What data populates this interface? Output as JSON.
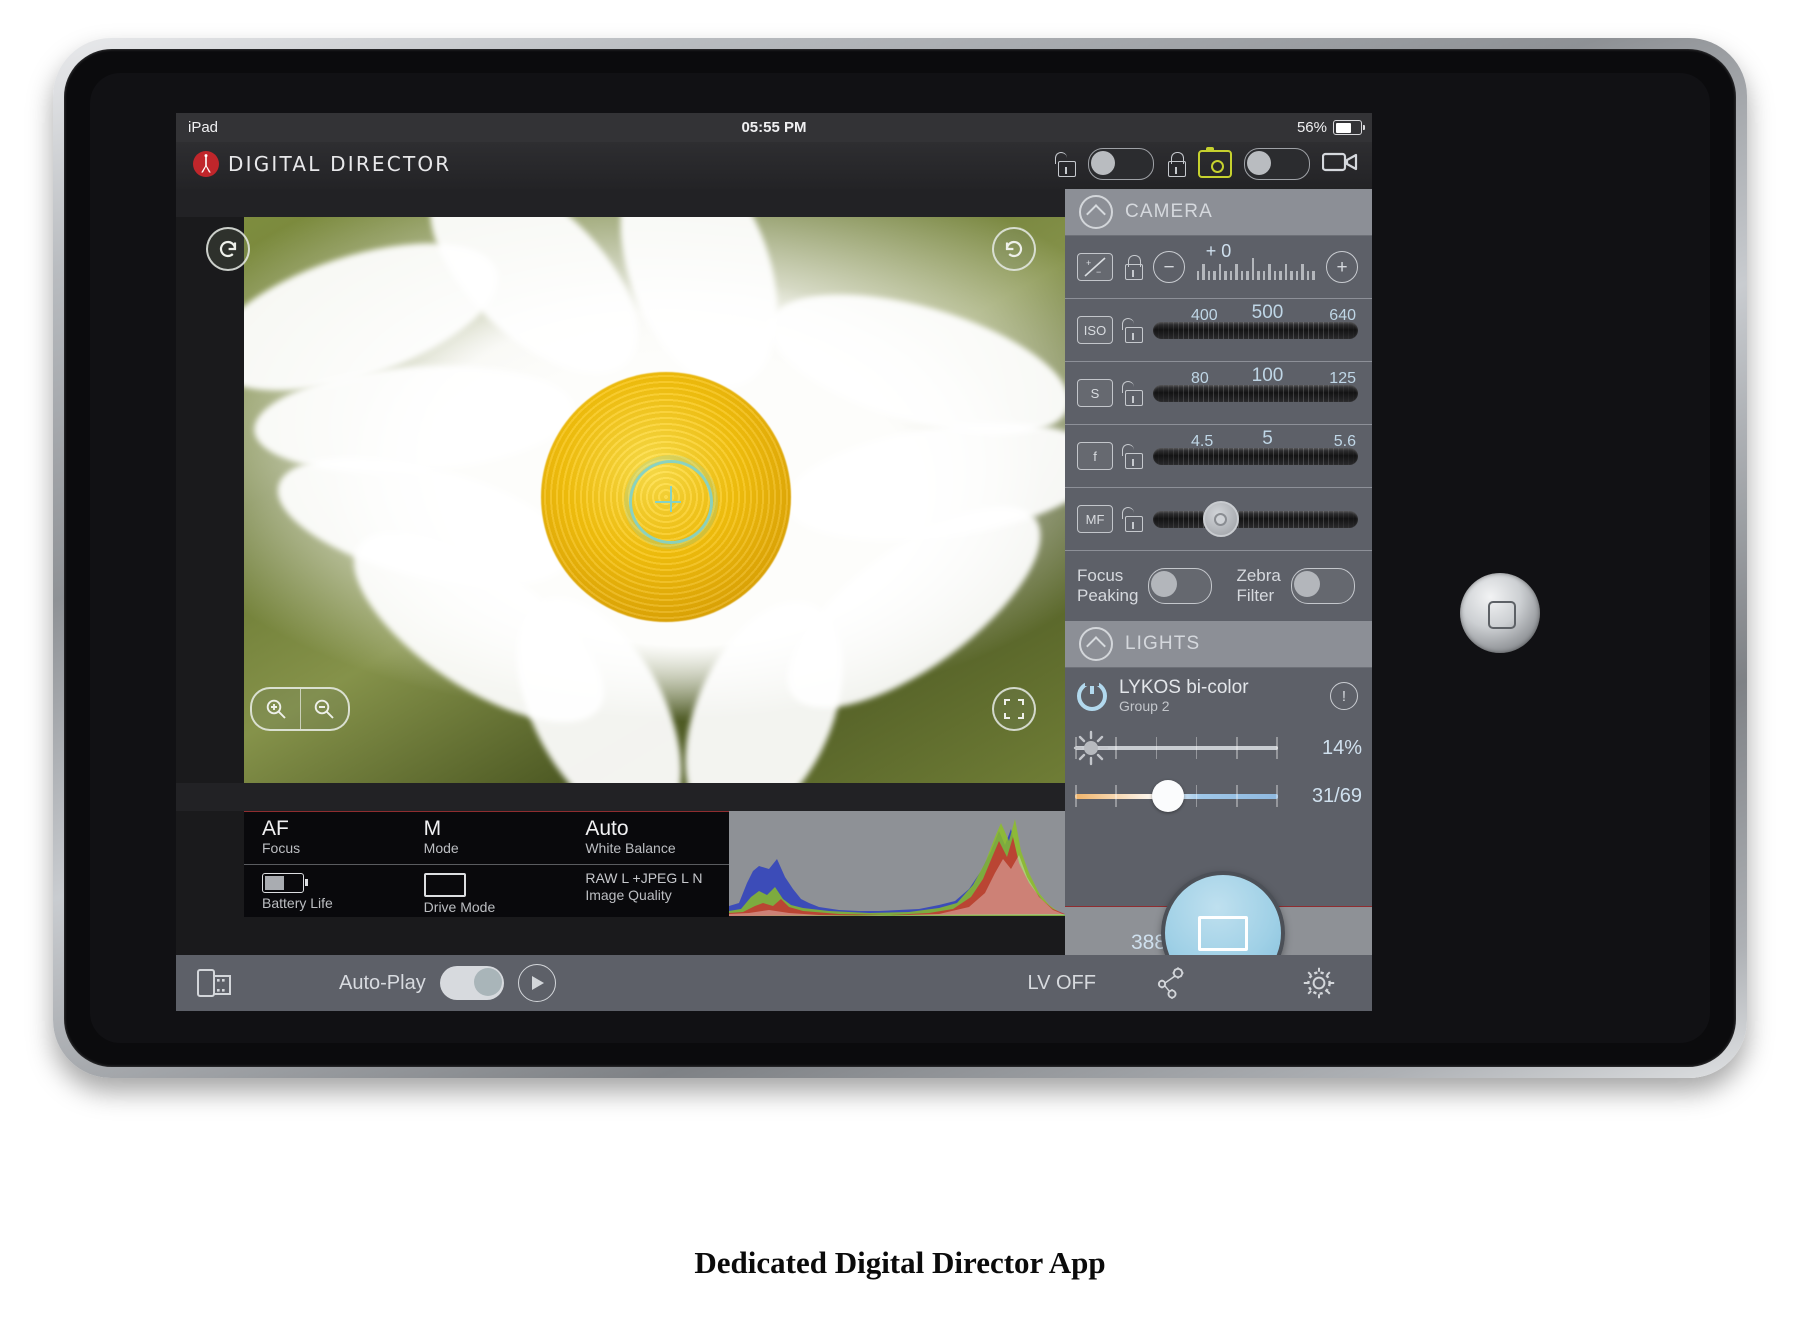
{
  "device": {
    "name": "iPad"
  },
  "statusbar": {
    "carrier": "iPad",
    "time": "05:55 PM",
    "battery_percent": "56%"
  },
  "appbar": {
    "logo_text": "DIGITAL DIRECTOR",
    "lock_open_icon": "unlock-icon",
    "lock_closed_icon": "lock-icon",
    "photo_icon": "camera-icon",
    "video_icon": "video-camera-icon"
  },
  "viewer": {
    "rotate_left_icon": "rotate-left-icon",
    "rotate_right_icon": "rotate-right-icon",
    "zoom_in_icon": "zoom-in-icon",
    "zoom_out_icon": "zoom-out-icon",
    "fullscreen_icon": "fullscreen-icon",
    "focus_point_icon": "focus-crosshair-icon"
  },
  "info_strip": {
    "cells": [
      {
        "value": "AF",
        "label": "Focus"
      },
      {
        "value": "M",
        "label": "Mode"
      },
      {
        "value": "Auto",
        "label": "White Balance"
      }
    ],
    "battery_label": "Battery Life",
    "drive_label": "Drive Mode",
    "quality_value": "RAW L +JPEG L N",
    "quality_label": "Image Quality"
  },
  "camera_panel": {
    "title": "CAMERA",
    "collapse_icon": "chevron-up-icon",
    "rows": [
      {
        "badge": "+/-",
        "icon": "exposure-compensation-icon",
        "locked": true,
        "current": "+ 0",
        "minus": "−",
        "plus": "+"
      },
      {
        "badge": "ISO",
        "icon": "iso-icon",
        "locked": false,
        "low": "400",
        "current": "500",
        "high": "640"
      },
      {
        "badge": "S",
        "icon": "shutter-speed-icon",
        "locked": false,
        "low": "80",
        "current": "100",
        "high": "125"
      },
      {
        "badge": "f",
        "icon": "aperture-icon",
        "locked": false,
        "low": "4.5",
        "current": "5",
        "high": "5.6"
      },
      {
        "badge": "MF",
        "icon": "manual-focus-icon",
        "locked": false
      }
    ],
    "focus_peaking_label": "Focus Peaking",
    "focus_peaking_state": "off",
    "zebra_filter_label": "Zebra Filter",
    "zebra_filter_state": "off"
  },
  "lights_panel": {
    "title": "LIGHTS",
    "collapse_icon": "chevron-up-icon",
    "light_name": "LYKOS bi-color",
    "light_group": "Group 2",
    "power_icon": "power-icon",
    "info_icon": "info-icon",
    "brightness_icon": "sun-icon",
    "brightness_value": "14%",
    "temperature_value": "31/69"
  },
  "shutter": {
    "count": "388",
    "icon": "rectangle-icon"
  },
  "toolbar": {
    "gallery_icon": "film-roll-icon",
    "autoplay_label": "Auto-Play",
    "autoplay_state": "on",
    "play_icon": "play-icon",
    "live_view_label": "LV OFF",
    "advanced_icon": "gears-icon",
    "settings_icon": "settings-gear-icon"
  },
  "colors": {
    "accent_red": "#8f2d30",
    "panel_gray": "#5d6068",
    "section_header": "#8c8f96",
    "value_blue": "#bfd6e6",
    "shutter_blue": "#9fd0e6"
  },
  "caption": "Dedicated Digital Director App"
}
